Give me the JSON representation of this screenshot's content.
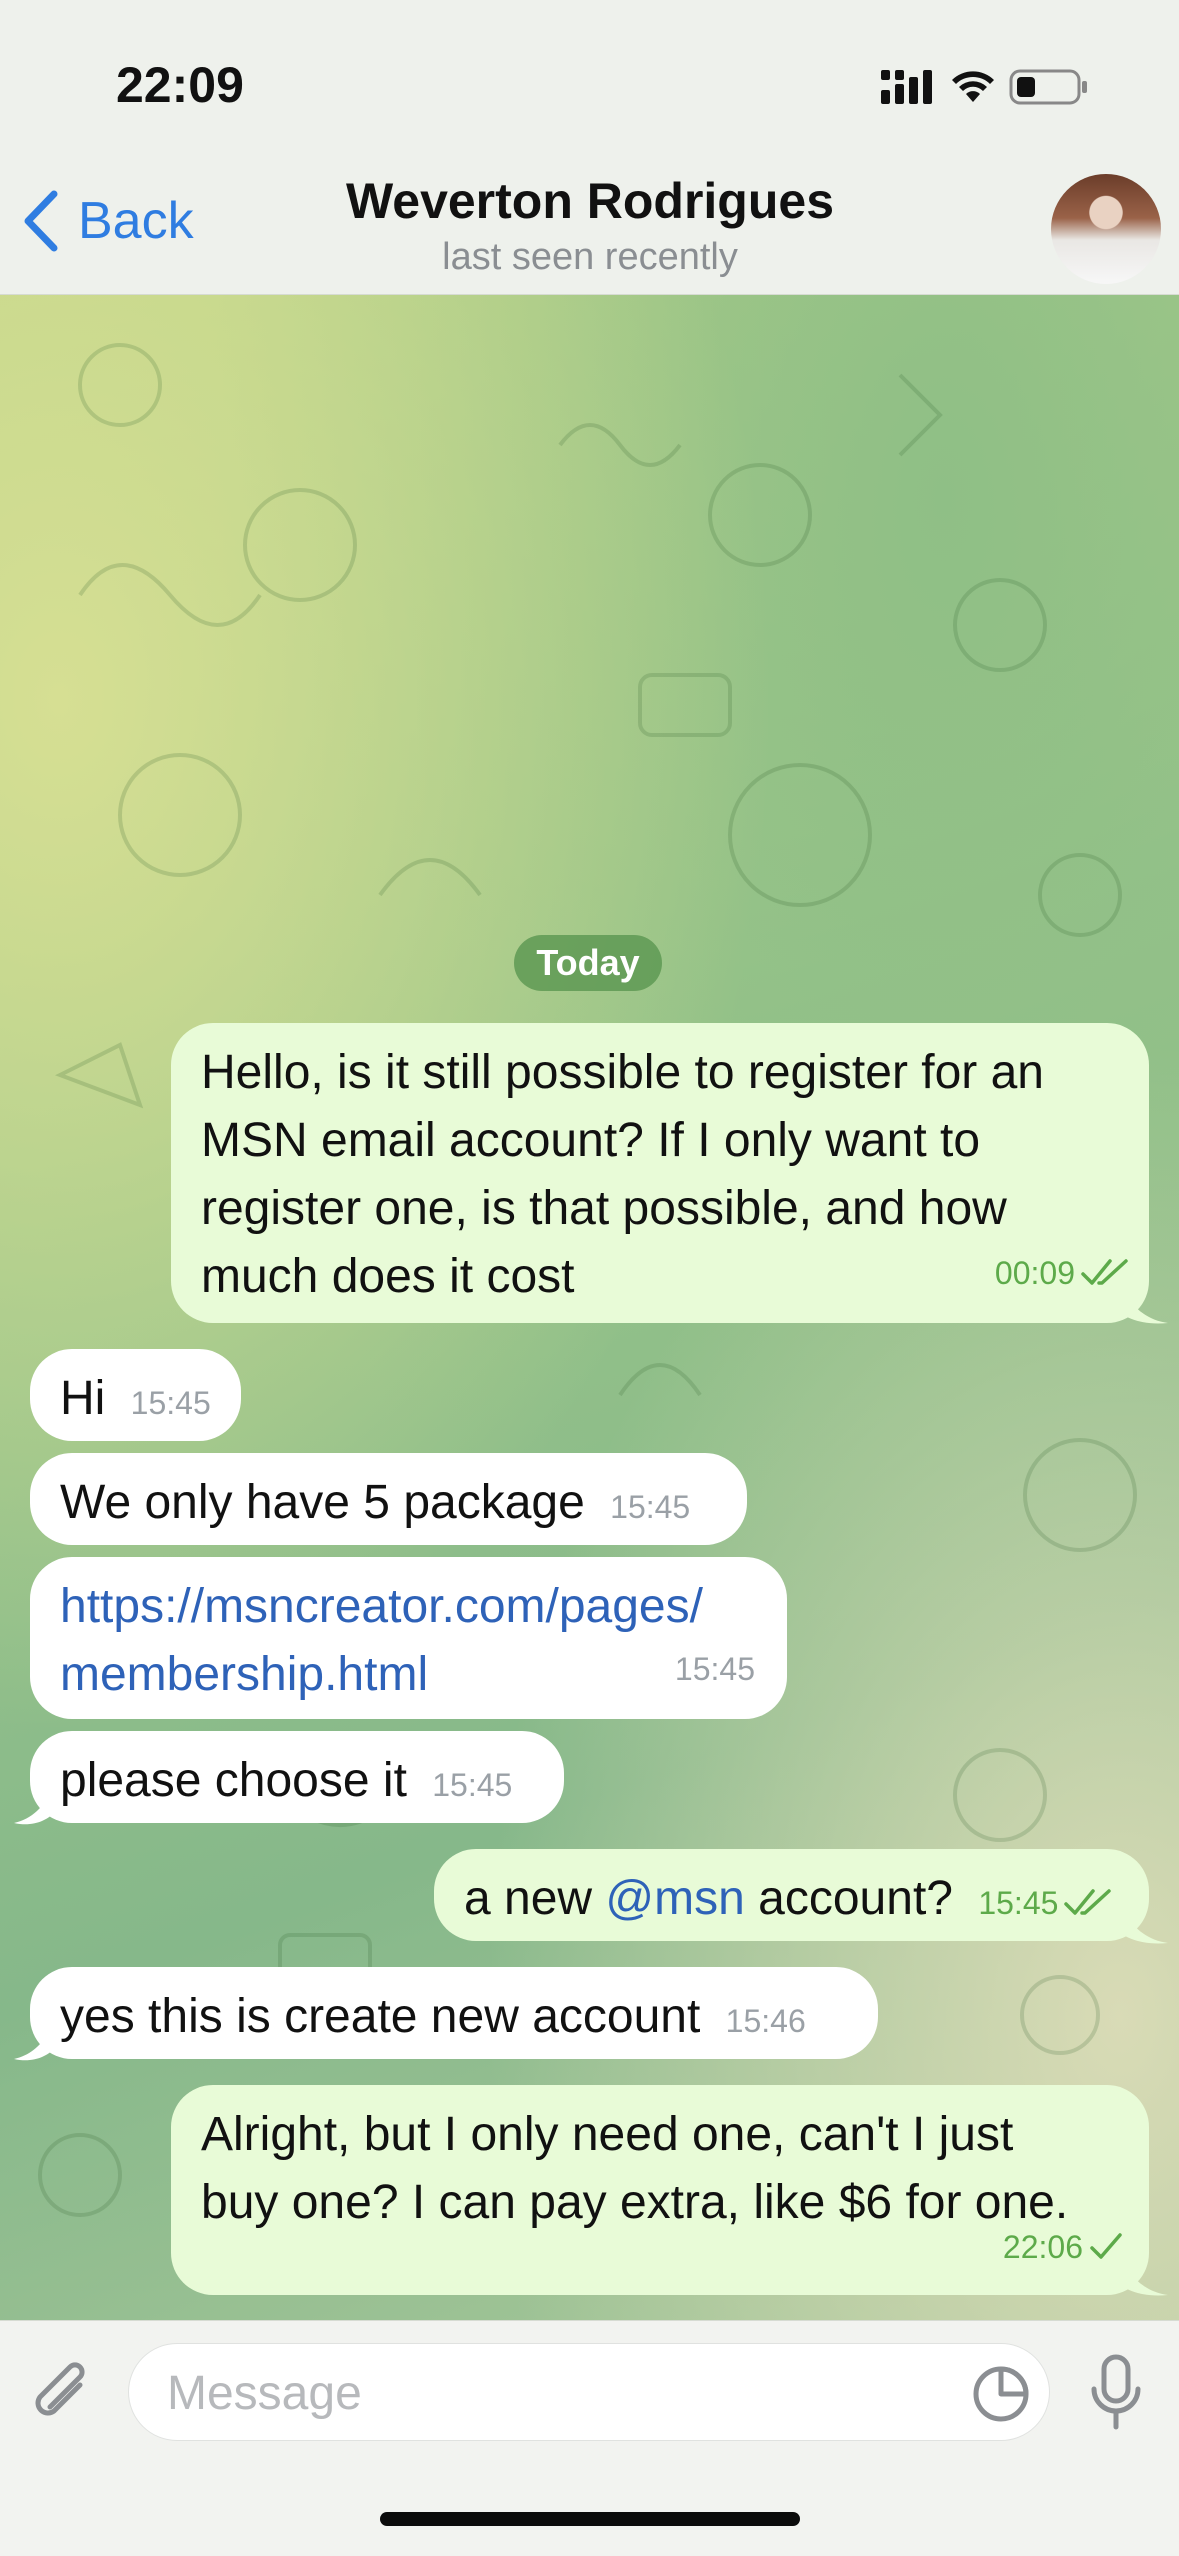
{
  "status_bar": {
    "time": "22:09"
  },
  "header": {
    "back_label": "Back",
    "contact_name": "Weverton Rodrigues",
    "contact_status": "last seen recently"
  },
  "chat": {
    "date_separator": "Today",
    "messages": [
      {
        "direction": "out",
        "text_lines": [
          "Hello, is it still possible to register for an",
          "MSN email account? If I only want to",
          "register one, is that possible, and how",
          "much does it cost"
        ],
        "time": "00:09",
        "read": "double-check"
      },
      {
        "direction": "in",
        "text": "Hi",
        "time": "15:45"
      },
      {
        "direction": "in",
        "text": "We only have 5 package",
        "time": "15:45"
      },
      {
        "direction": "in",
        "link_lines": [
          "https://msncreator.com/pages/",
          "membership.html"
        ],
        "time": "15:45"
      },
      {
        "direction": "in",
        "text": "please choose it",
        "time": "15:45"
      },
      {
        "direction": "out",
        "text_before": "a new ",
        "mention": "@msn",
        "text_after": " account?",
        "time": "15:45",
        "read": "double-check"
      },
      {
        "direction": "in",
        "text": "yes this is create new account",
        "time": "15:46"
      },
      {
        "direction": "out",
        "text_lines": [
          "Alright, but I only need one, can't I just",
          "buy one? I can pay extra, like $6 for one."
        ],
        "time": "22:06",
        "read": "single-check"
      }
    ]
  },
  "composer": {
    "placeholder": "Message"
  },
  "icons": {
    "back": "chevron-left-icon",
    "attach": "paperclip-icon",
    "sticker": "sticker-icon",
    "mic": "microphone-icon",
    "signal": "signal-icon",
    "wifi": "wifi-icon",
    "battery": "battery-icon"
  },
  "colors": {
    "accent": "#2f7de1",
    "outgoing_bubble": "#e8fbd7",
    "incoming_bubble": "#ffffff",
    "read_check": "#5daa4a"
  }
}
